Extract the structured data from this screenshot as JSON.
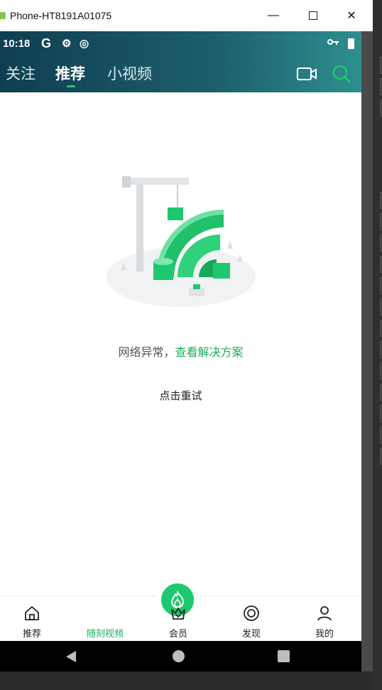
{
  "window": {
    "title": "Phone-HT8191A01075",
    "minimize": "—",
    "close": "✕"
  },
  "statusbar": {
    "time": "10:18",
    "g": "G",
    "icon2": "⚙",
    "icon3": "◎"
  },
  "tabs": [
    {
      "label": "关注"
    },
    {
      "label": "推荐"
    },
    {
      "label": "小视频"
    }
  ],
  "error": {
    "message": "网络异常，",
    "link": "查看解决方案",
    "retry": "点击重试"
  },
  "bottomnav": [
    {
      "label": "推荐",
      "icon": "home-icon"
    },
    {
      "label": "随刻视频",
      "icon": "flame-icon"
    },
    {
      "label": "会员",
      "icon": "crown-icon"
    },
    {
      "label": "发现",
      "icon": "discover-icon"
    },
    {
      "label": "我的",
      "icon": "user-icon"
    }
  ],
  "colors": {
    "accent": "#1ec86f",
    "header_dark": "#0f3e51",
    "header_light": "#2e8f8e"
  }
}
